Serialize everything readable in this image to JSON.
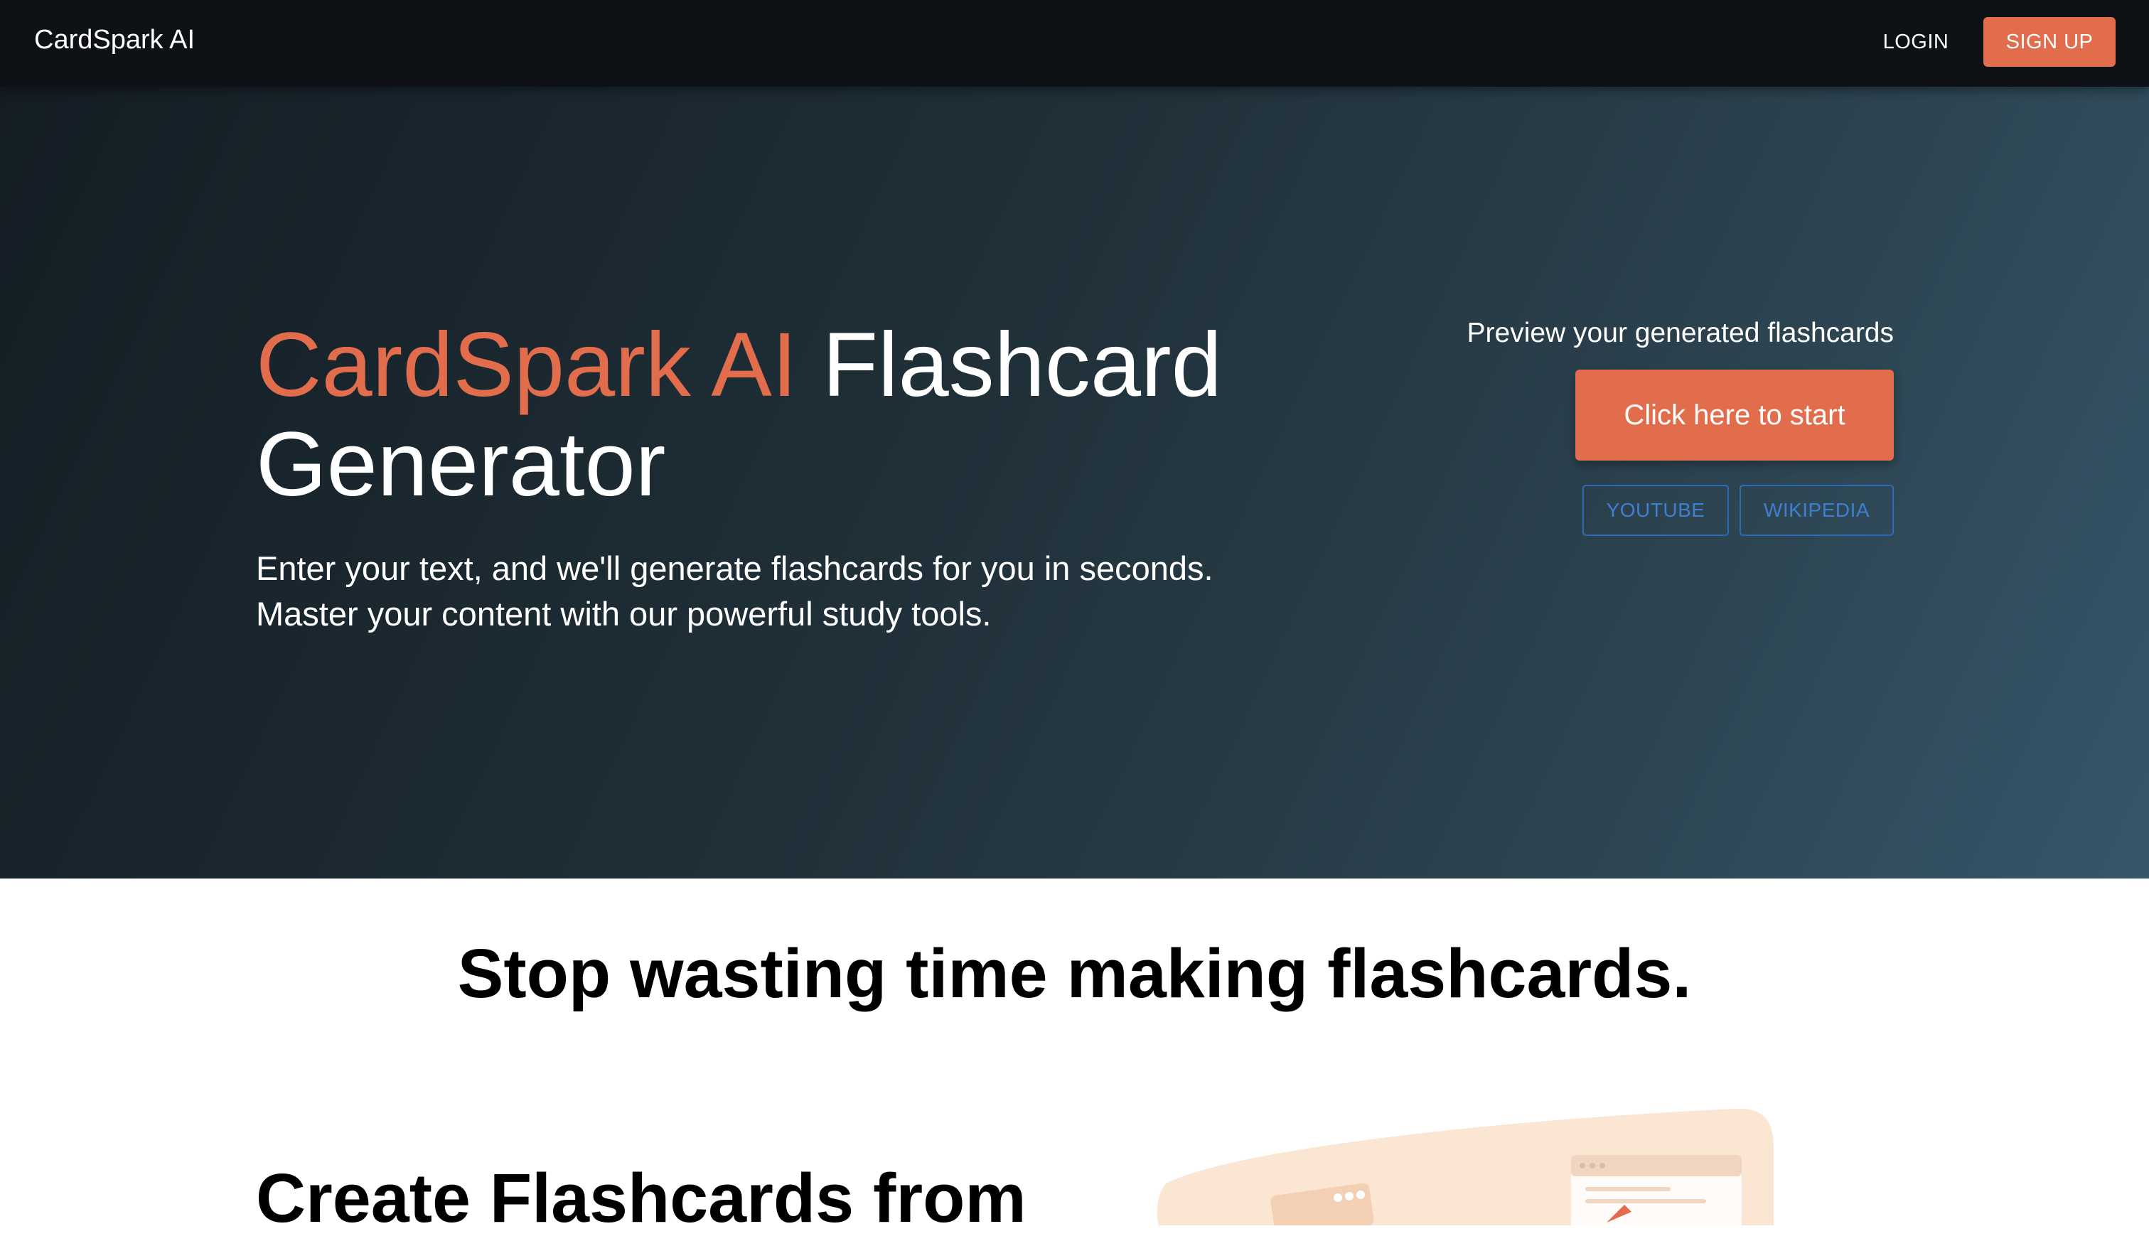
{
  "header": {
    "brand": "CardSpark AI",
    "login_label": "LOGIN",
    "signup_label": "SIGN UP"
  },
  "hero": {
    "title_accent": "CardSpark AI",
    "title_rest": "Flashcard Generator",
    "subtitle": "Enter your text, and we'll generate flashcards for you in seconds. Master your content with our powerful study tools.",
    "preview_label": "Preview your generated flashcards",
    "start_button": "Click here to start",
    "source_buttons": [
      "YOUTUBE",
      "WIKIPEDIA"
    ]
  },
  "main": {
    "tagline": "Stop wasting time making flashcards.",
    "feature_title": "Create Flashcards from"
  },
  "colors": {
    "accent": "#e16d4c",
    "nav_bg": "#0e1116",
    "link_blue": "#3f7fd0",
    "illustration_bg": "#fbe5d3"
  }
}
